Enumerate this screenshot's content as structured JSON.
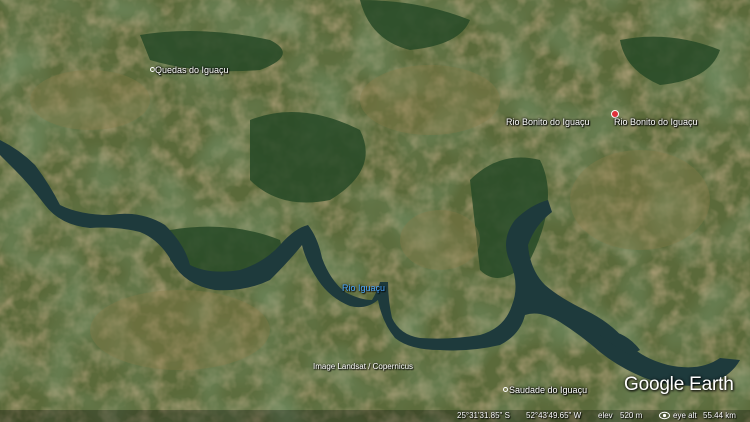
{
  "places": {
    "quedas": "Quedas do Iguaçu",
    "rio_bonito_left": "Rio Bonito do Iguaçu",
    "rio_bonito_right": "Rio Bonito do Iguaçu",
    "saudade": "Saudade do Iguaçu"
  },
  "river_label": "Rio Iguaçu",
  "attribution": "Image Landsat / Copernicus",
  "logo": "Google Earth",
  "status": {
    "lat": "25°31'31.85\" S",
    "lon": "52°43'49.65\" W",
    "elev_label": "elev",
    "elev": "520 m",
    "eye_alt_label": "eye alt",
    "eye_alt": "55.44 km"
  },
  "colors": {
    "river": "#4aa8ff",
    "pin": "#e0303a",
    "water": "#1e3a3c",
    "forest": "#234d25"
  },
  "icons": {
    "eye": "eye-icon",
    "pin": "map-pin-icon"
  }
}
